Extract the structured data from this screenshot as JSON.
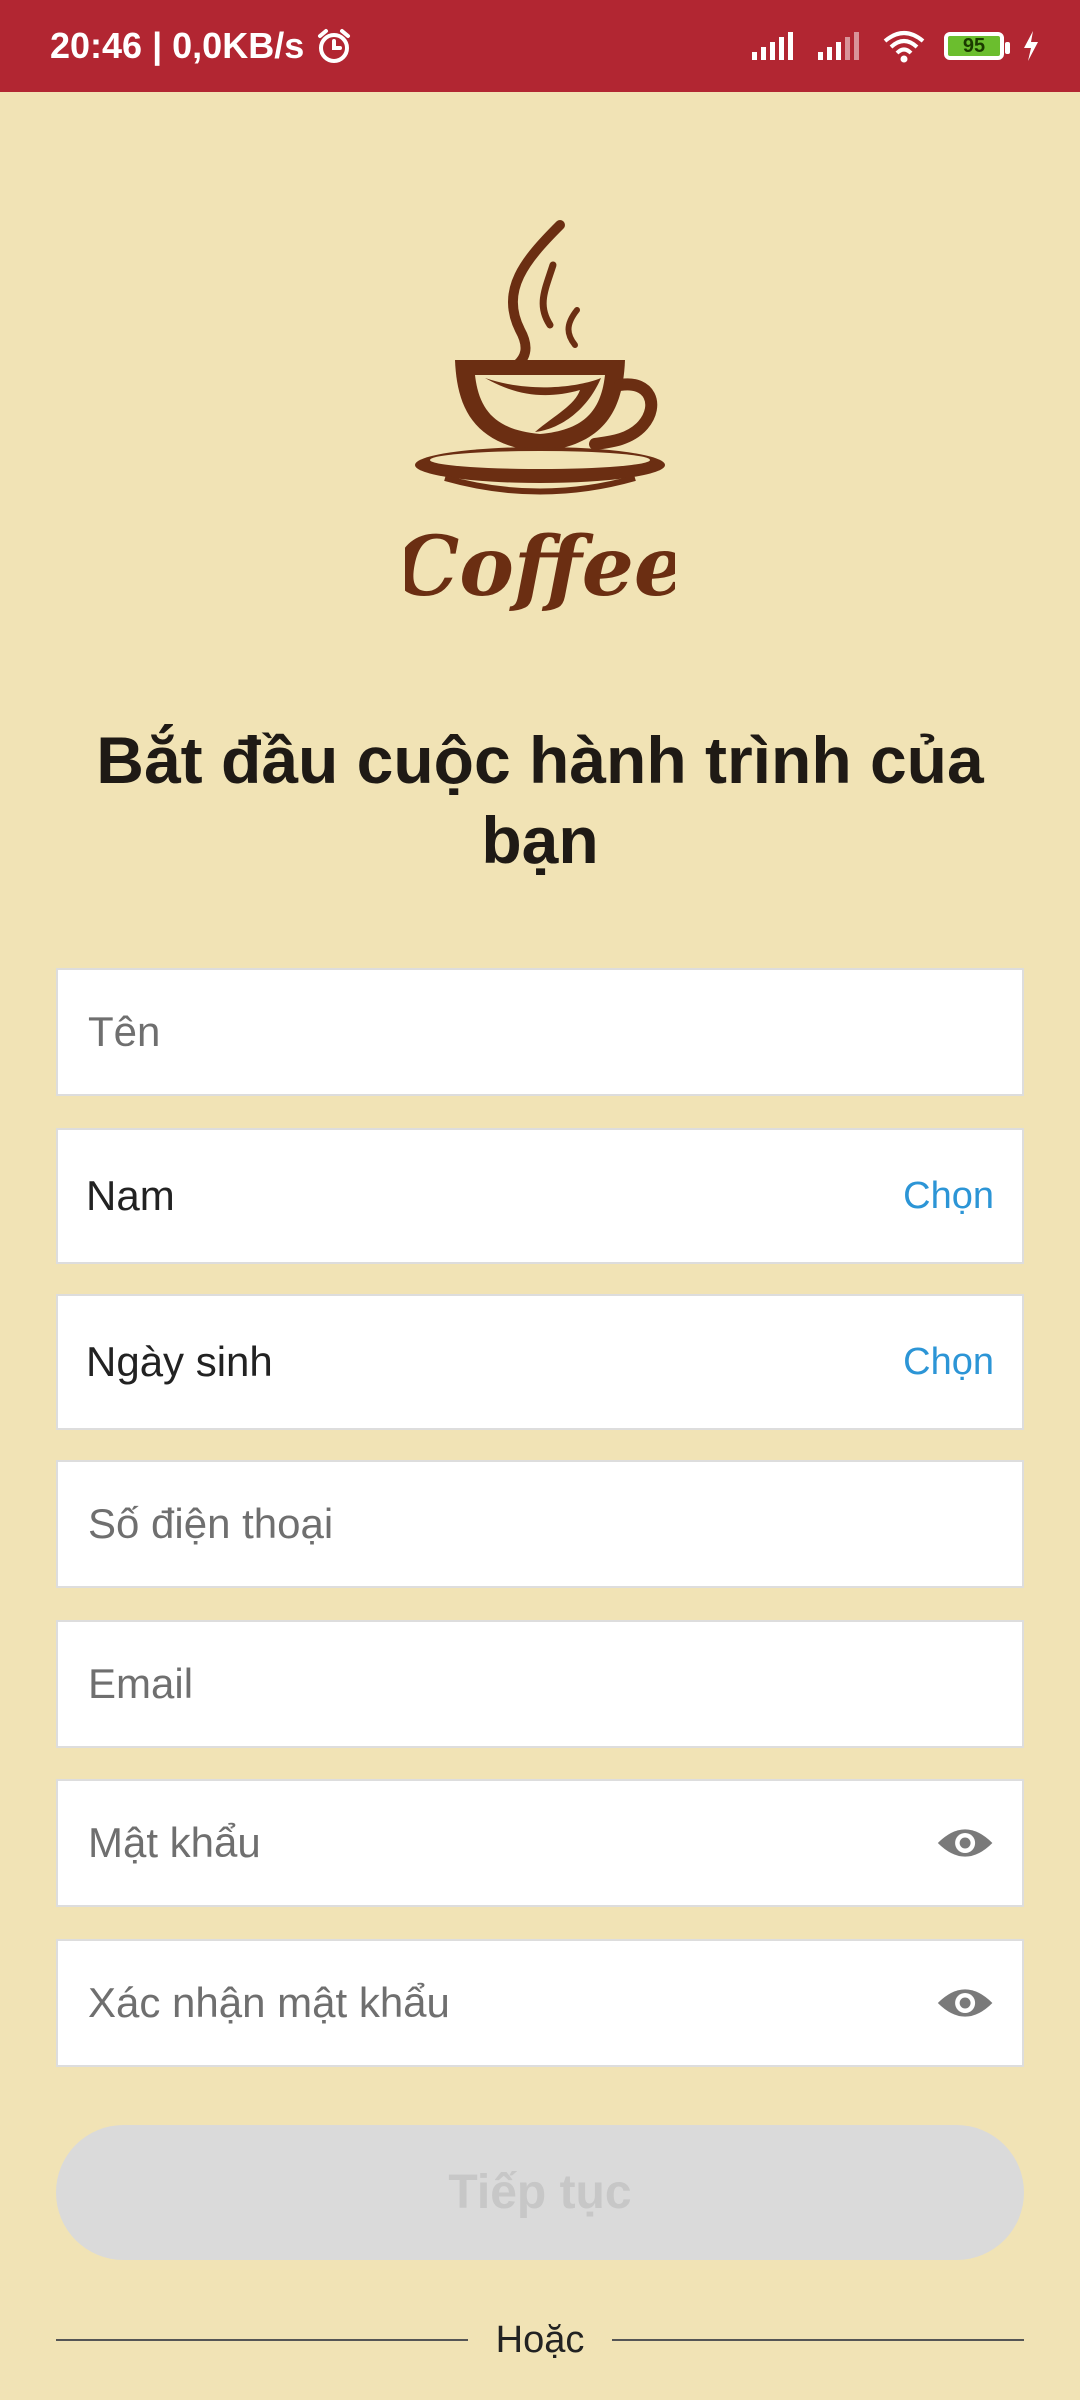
{
  "status_bar": {
    "time_speed": "20:46 | 0,0KB/s",
    "battery": "95",
    "icons": [
      "alarm-icon",
      "signal-icon",
      "signal-icon",
      "wifi-icon",
      "battery-icon",
      "charging-icon"
    ]
  },
  "logo": {
    "text": "Coffee"
  },
  "heading": "Bắt đầu cuộc hành trình của bạn",
  "form": {
    "name_placeholder": "Tên",
    "gender_value": "Nam",
    "gender_choose": "Chọn",
    "birthday_value": "Ngày sinh",
    "birthday_choose": "Chọn",
    "phone_placeholder": "Số điện thoại",
    "email_placeholder": "Email",
    "password_placeholder": "Mật khẩu",
    "confirm_password_placeholder": "Xác nhận mật khẩu"
  },
  "continue_label": "Tiếp tục",
  "or_label": "Hoặc",
  "colors": {
    "status_bar": "#B22632",
    "background": "#F1E3B5",
    "link": "#2C95D6",
    "coffee_brown": "#6B2E12",
    "button_disabled": "#DADADA"
  }
}
